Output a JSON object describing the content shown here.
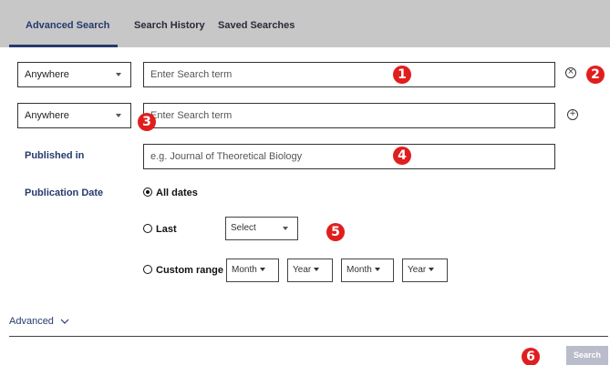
{
  "tabs": [
    {
      "label": "Advanced Search",
      "active": true
    },
    {
      "label": "Search History",
      "active": false
    },
    {
      "label": "Saved Searches",
      "active": false
    }
  ],
  "row1": {
    "field": "Anywhere",
    "placeholder": "Enter Search term"
  },
  "row2": {
    "field": "Anywhere",
    "placeholder": "Enter Search term"
  },
  "published": {
    "label": "Published in",
    "placeholder": "e.g. Journal of Theoretical Biology"
  },
  "pubdate": {
    "label": "Publication Date",
    "all_dates": "All dates",
    "last": "Last",
    "last_select": "Select",
    "custom_range": "Custom range",
    "month1": "Month",
    "year1": "Year",
    "month2": "Month",
    "year2": "Year"
  },
  "advanced_toggle": "Advanced",
  "search_button": "Search",
  "markers": [
    "1",
    "2",
    "3",
    "4",
    "5",
    "6"
  ],
  "icons": {
    "remove": "circle-x-icon",
    "add": "circle-plus-icon",
    "chevron": "chevron-down-icon"
  },
  "colors": {
    "accent": "#263a6e",
    "marker": "#e01e1e",
    "tabbar": "#c7c7c7",
    "search_button": "#b9bccb"
  }
}
